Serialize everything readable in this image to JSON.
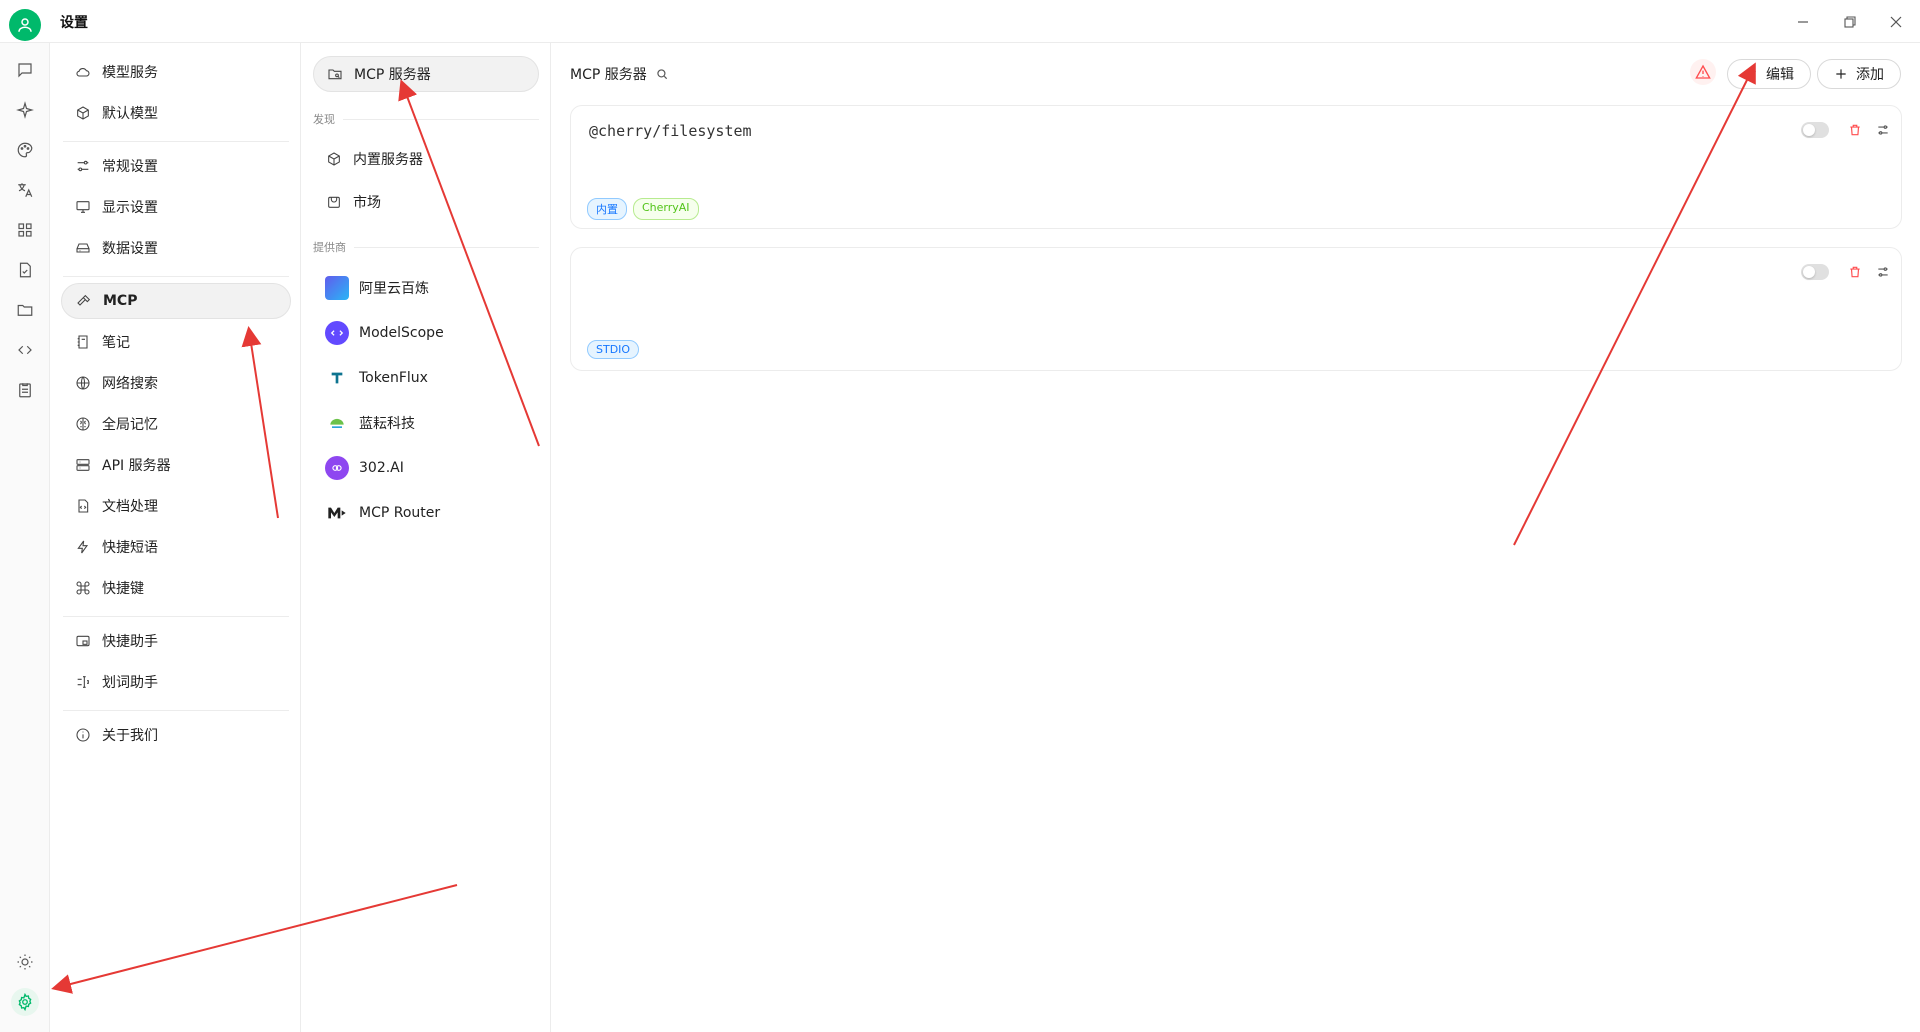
{
  "window": {
    "title": "设置"
  },
  "rail": {
    "items": [
      "chat-icon",
      "sparkle-icon",
      "palette-icon",
      "translate-icon",
      "apps-icon",
      "files-icon",
      "folder-icon",
      "code-icon",
      "notes-icon"
    ],
    "bottom": [
      "sun-icon",
      "settings-gear-icon"
    ]
  },
  "menu": {
    "items": [
      {
        "label": "模型服务",
        "icon": "cloud-icon"
      },
      {
        "label": "默认模型",
        "icon": "cube-icon"
      },
      {
        "label": "常规设置",
        "icon": "sliders-icon"
      },
      {
        "label": "显示设置",
        "icon": "monitor-icon"
      },
      {
        "label": "数据设置",
        "icon": "hard-drive-icon"
      },
      {
        "label": "MCP",
        "icon": "hammer-icon",
        "active": true
      },
      {
        "label": "笔记",
        "icon": "notebook-icon"
      },
      {
        "label": "网络搜索",
        "icon": "globe-icon"
      },
      {
        "label": "全局记忆",
        "icon": "brain-icon"
      },
      {
        "label": "API 服务器",
        "icon": "server-icon"
      },
      {
        "label": "文档处理",
        "icon": "document-icon"
      },
      {
        "label": "快捷短语",
        "icon": "bolt-icon"
      },
      {
        "label": "快捷键",
        "icon": "command-icon"
      },
      {
        "label": "快捷助手",
        "icon": "window-icon"
      },
      {
        "label": "划词助手",
        "icon": "text-select-icon"
      },
      {
        "label": "关于我们",
        "icon": "info-icon"
      }
    ]
  },
  "sub": {
    "active_label": "MCP 服务器",
    "discover_heading": "发现",
    "discover_items": [
      {
        "label": "内置服务器",
        "icon": "package-icon"
      },
      {
        "label": "市场",
        "icon": "store-icon"
      }
    ],
    "providers_heading": "提供商",
    "providers": [
      {
        "label": "阿里云百炼",
        "color": "#615ced"
      },
      {
        "label": "ModelScope",
        "color": "#624aff"
      },
      {
        "label": "TokenFlux",
        "color": "#0e7490"
      },
      {
        "label": "蓝耘科技",
        "color": "#2aa4d8"
      },
      {
        "label": "302.AI",
        "color": "#8e47f0"
      },
      {
        "label": "MCP Router",
        "color": "#222222"
      }
    ]
  },
  "main": {
    "title": "MCP 服务器",
    "edit_label": "编辑",
    "add_label": "添加",
    "servers": [
      {
        "name": "@cherry/filesystem",
        "enabled": false,
        "tags": [
          {
            "label": "内置",
            "color": "#1677ff"
          },
          {
            "label": "CherryAI",
            "color": "#52c41a"
          }
        ]
      },
      {
        "name": "",
        "enabled": false,
        "tags": [
          {
            "label": "STDIO",
            "color": "#1677ff"
          }
        ]
      }
    ]
  },
  "colors": {
    "accent": "#00b96b",
    "annotation": "#e53935",
    "danger": "#ff4d4f"
  }
}
